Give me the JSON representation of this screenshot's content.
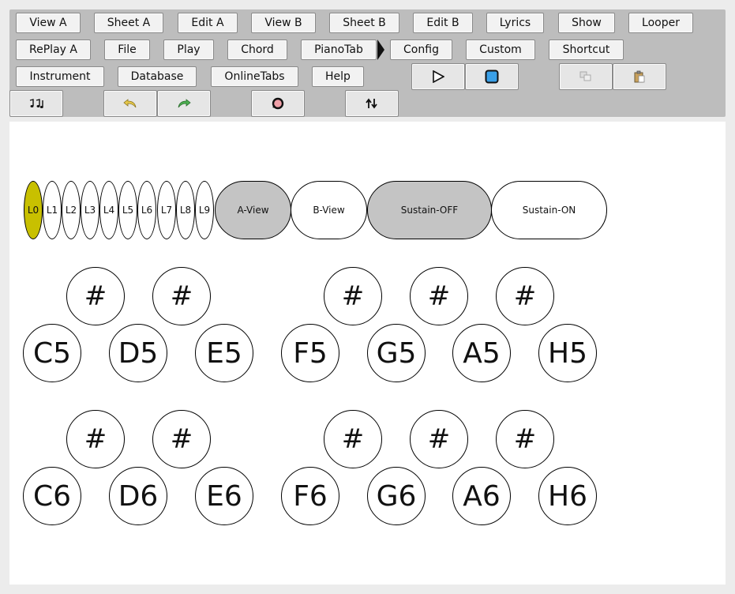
{
  "toolbar": {
    "row1": [
      "View A",
      "Sheet A",
      "Edit A",
      "View B",
      "Sheet B",
      "Edit B",
      "Lyrics",
      "Show",
      "Looper"
    ],
    "row2": [
      "RePlay A",
      "File",
      "Play",
      "Chord",
      "PianoTab",
      "Config",
      "Custom",
      "Shortcut"
    ],
    "row3": [
      "Instrument",
      "Database",
      "OnlineTabs",
      "Help"
    ],
    "icons": [
      "play-icon",
      "stop-icon",
      "copy-icon",
      "paste-icon",
      "notes-icon",
      "undo-icon",
      "redo-icon",
      "record-icon",
      "swap-icon"
    ],
    "accent_stop": "#3aa0e8",
    "accent_undo": "#e6c84a",
    "accent_redo": "#4caf50",
    "accent_record": "#f0a0a8"
  },
  "layers": {
    "items": [
      "L0",
      "L1",
      "L2",
      "L3",
      "L4",
      "L5",
      "L6",
      "L7",
      "L8",
      "L9"
    ],
    "active": "L0",
    "active_color": "#c8c000"
  },
  "view_buttons": {
    "a_view": "A-View",
    "b_view": "B-View",
    "sustain_off": "Sustain-OFF",
    "sustain_on": "Sustain-ON"
  },
  "keyboard": {
    "sharp_label": "#",
    "octave5": [
      "C5",
      "D5",
      "E5",
      "F5",
      "G5",
      "A5",
      "H5"
    ],
    "octave6": [
      "C6",
      "D6",
      "E6",
      "F6",
      "G6",
      "A6",
      "H6"
    ]
  }
}
